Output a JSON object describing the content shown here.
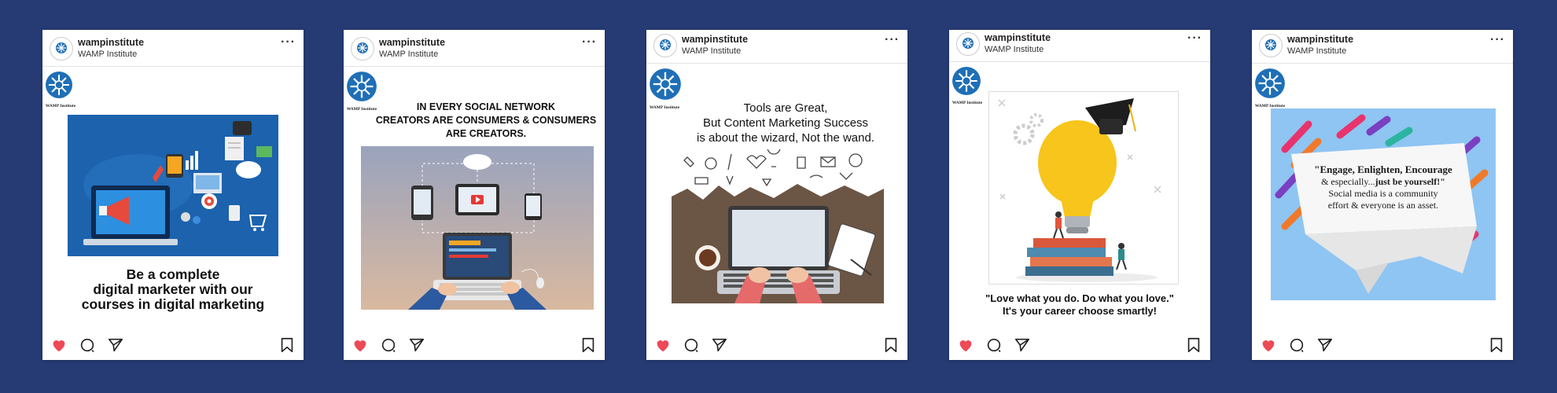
{
  "posts": [
    {
      "username": "wampinstitute",
      "account_name": "WAMP Institute",
      "logo_caption": "WAMP Institute",
      "caption": "Be a complete\ndigital marketer with our\ncourses in digital marketing",
      "liked": true
    },
    {
      "username": "wampinstitute",
      "account_name": "WAMP Institute",
      "logo_caption": "WAMP Institute",
      "headline": "IN EVERY SOCIAL NETWORK\nCREATORS ARE CONSUMERS & CONSUMERS\nARE CREATORS.",
      "liked": true
    },
    {
      "username": "wampinstitute",
      "account_name": "WAMP Institute",
      "logo_caption": "WAMP Institute",
      "headline": "Tools are Great,\nBut Content Marketing Success\nis about the wizard, Not the wand.",
      "liked": true
    },
    {
      "username": "wampinstitute",
      "account_name": "WAMP Institute",
      "logo_caption": "WAMP Institute",
      "caption": "\"Love what you do. Do what you love.\"\nIt's your career choose smartly!",
      "liked": true
    },
    {
      "username": "wampinstitute",
      "account_name": "WAMP Institute",
      "logo_caption": "WAMP Institute",
      "quote_line1_regular": "Engage, Enlighten, Encourage",
      "quote_line2_regular": "& especially...",
      "quote_line2_bold": "just be yourself!\"",
      "quote_rest": "Social media is a community\neffort & everyone is an asset.",
      "quote_open": "\"",
      "liked": true
    }
  ],
  "icons": {
    "more": "more-options-icon",
    "like": "heart-icon",
    "comment": "comment-icon",
    "share": "share-icon",
    "save": "bookmark-icon"
  },
  "colors": {
    "background": "#263a73",
    "like": "#ed4956",
    "brand": "#1f6fb6"
  },
  "more_label": "···"
}
